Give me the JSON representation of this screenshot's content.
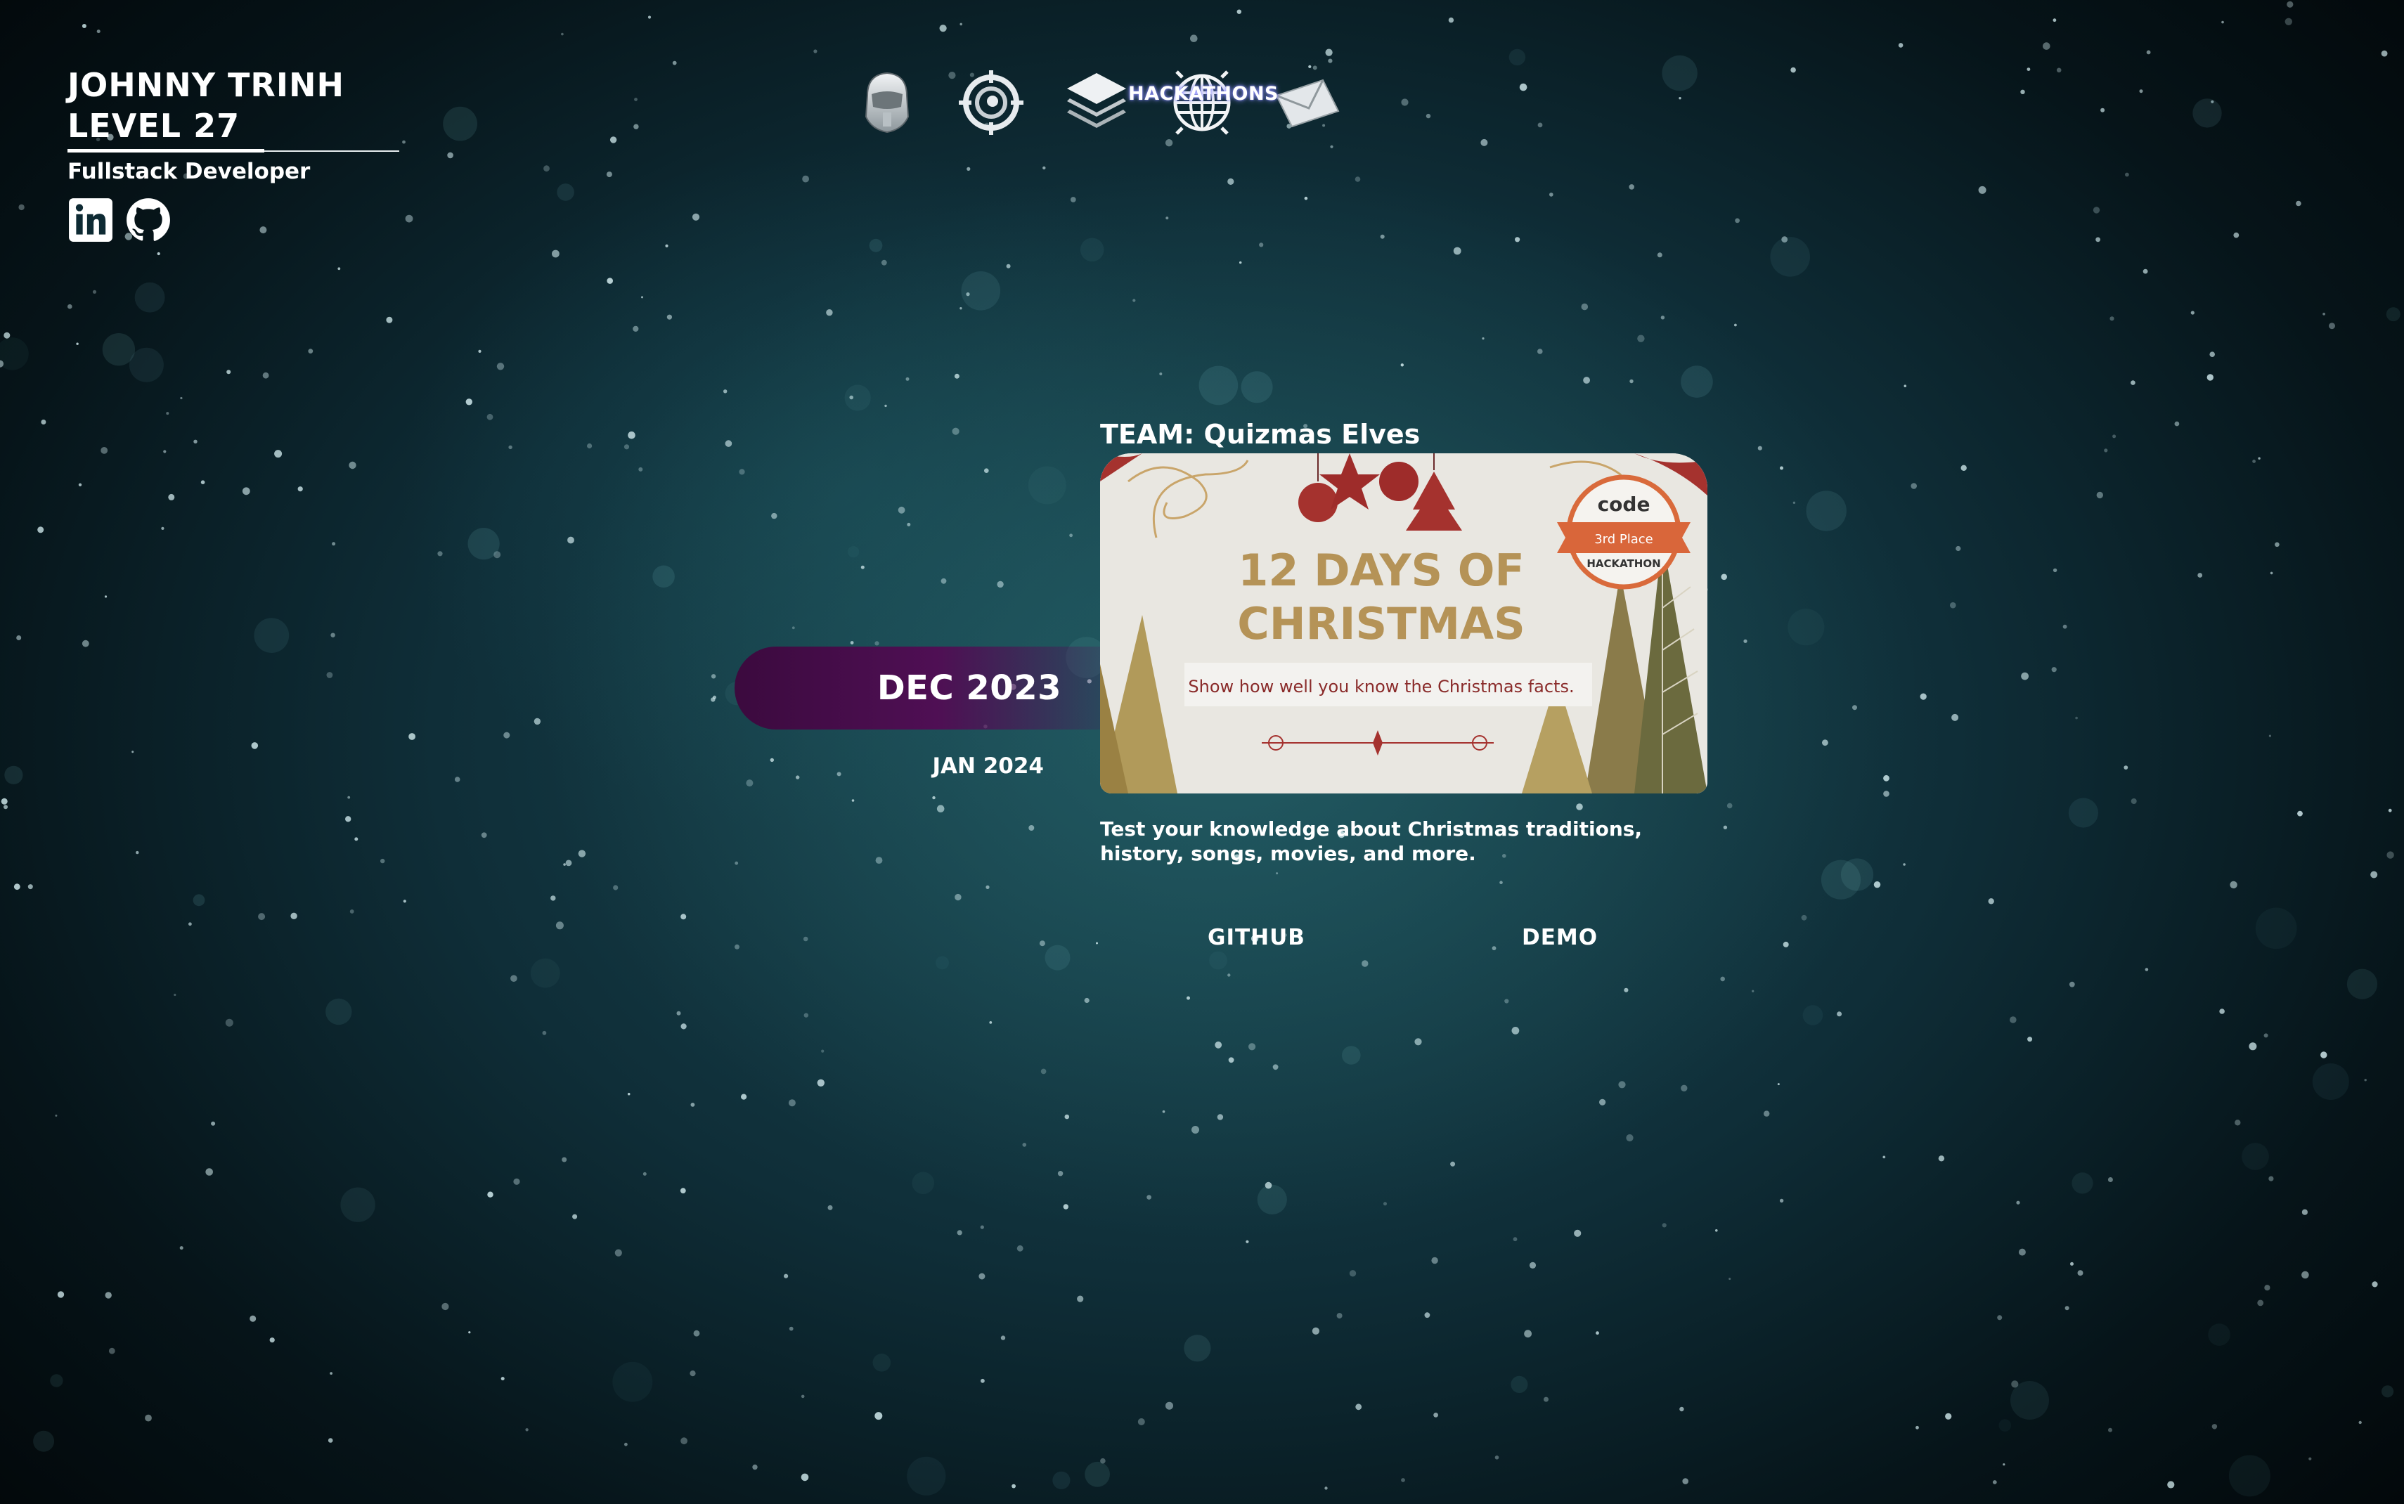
{
  "header": {
    "name": "JOHNNY TRINH",
    "level": "LEVEL 27",
    "role": "Fullstack Developer",
    "socials": [
      {
        "icon": "linkedin-icon"
      },
      {
        "icon": "github-icon"
      }
    ]
  },
  "nav": {
    "items": [
      {
        "icon": "helmet-icon"
      },
      {
        "icon": "target-icon"
      },
      {
        "icon": "layers-icon"
      },
      {
        "icon": "globe-icon",
        "active": true
      },
      {
        "icon": "mail-icon"
      }
    ],
    "active_label": "HACKATHONS"
  },
  "timeline": {
    "active": "DEC 2023",
    "items": [
      "JAN 2024"
    ],
    "accent": "#4f0f54"
  },
  "project": {
    "team": "TEAM: Quizmas Elves",
    "image": {
      "title_line1": "12 DAYS OF",
      "title_line2": "CHRISTMAS",
      "subtitle": "Show how well you know the Christmas facts.",
      "badge_brand": "code",
      "badge_place": "3rd Place",
      "badge_event": "HACKATHON"
    },
    "description": "Test your knowledge about Christmas traditions, history, songs, movies, and more.",
    "github_label": "GITHUB",
    "demo_label": "DEMO"
  }
}
